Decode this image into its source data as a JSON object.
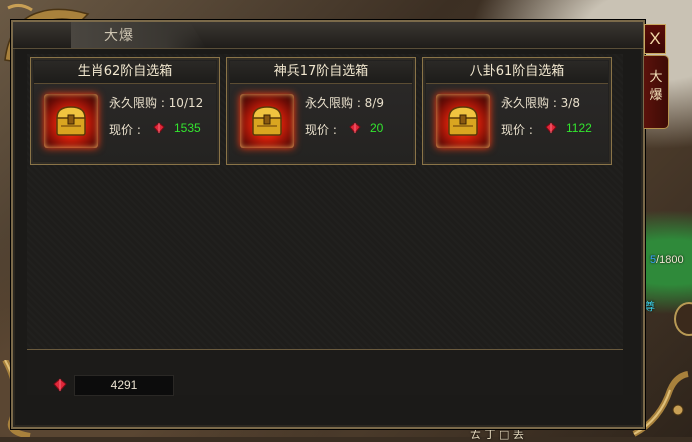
{
  "window": {
    "title": "大爆",
    "close_label": "X",
    "side_tab": [
      "大",
      "爆"
    ]
  },
  "items": [
    {
      "name": "生肖62阶自选箱",
      "limit_label": "永久限购 : 10/12",
      "price_label": "现价 :",
      "price": "1535"
    },
    {
      "name": "神兵17阶自选箱",
      "limit_label": "永久限购 : 8/9",
      "price_label": "现价 :",
      "price": "20"
    },
    {
      "name": "八卦61阶自选箱",
      "limit_label": "永久限购 : 3/8",
      "price_label": "现价 :",
      "price": "1122"
    }
  ],
  "balance": {
    "value": "4291"
  },
  "background": {
    "hp_prefix": "5",
    "hp_text": "/1800",
    "side_text": "尊",
    "bottom_text": "ㄊ 丁 □ 丢"
  },
  "colors": {
    "price_green": "#33e62f",
    "accent_gold": "#8a7448",
    "close_red": "#5a0d08"
  },
  "icons": {
    "chest": "treasure-chest-icon",
    "currency": "red-gem-icon"
  }
}
